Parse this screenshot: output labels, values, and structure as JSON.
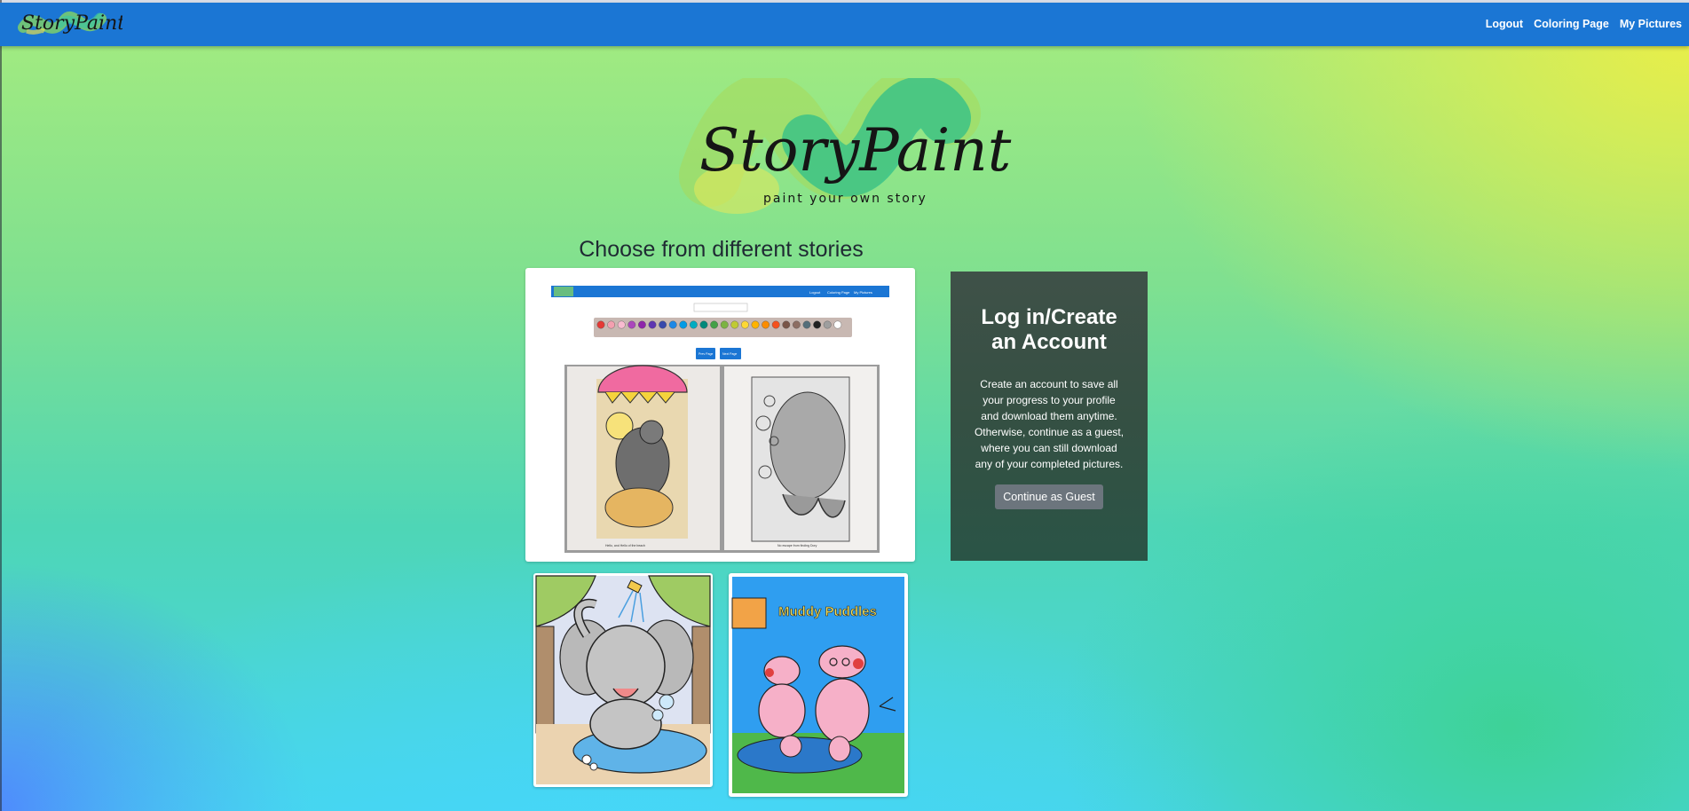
{
  "nav": {
    "logo_text": "StoryPaint",
    "links": [
      "Logout",
      "Coloring Page",
      "My Pictures"
    ]
  },
  "hero": {
    "logo_title": "StoryPaint",
    "logo_tagline": "paint your own story"
  },
  "stories": {
    "heading": "Choose from different stories"
  },
  "preview": {
    "nav_links": [
      "Logout",
      "Coloring Page",
      "My Pictures"
    ],
    "button_labels": [
      "Prev Page",
      "Next Page"
    ],
    "left_caption": "Hello, and Hello of the beach",
    "right_caption": "No escape from finding Dory",
    "palette": [
      "#e53935",
      "#f4a0b0",
      "#f8bbd0",
      "#ab47bc",
      "#8e24aa",
      "#5e35b1",
      "#3949ab",
      "#1e88e5",
      "#039be5",
      "#00acc1",
      "#00897b",
      "#43a047",
      "#7cb342",
      "#c0ca33",
      "#fdd835",
      "#ffb300",
      "#fb8c00",
      "#f4511e",
      "#795548",
      "#8d6e63",
      "#546e7a",
      "#212121",
      "#9e9e9e",
      "#ffffff"
    ]
  },
  "login": {
    "title": "Log in/Create an Account",
    "description": "Create an account to save all your progress to your profile and download them anytime. Otherwise, continue as a guest, where you can still download any of your completed pictures.",
    "guest_button": "Continue as Guest"
  },
  "thumbnails": {
    "second_title": "Muddy Puddles"
  },
  "colors": {
    "navbar": "#1b76d4",
    "panel": "#355043",
    "guest_button": "#6c757d"
  }
}
